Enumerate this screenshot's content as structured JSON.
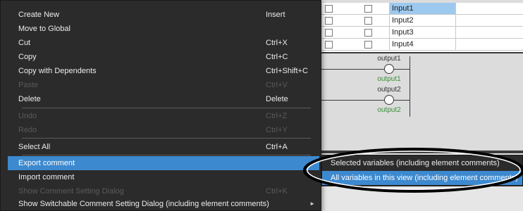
{
  "variables_table": {
    "rows": [
      {
        "name": "Input1",
        "selected": true
      },
      {
        "name": "Input2",
        "selected": false
      },
      {
        "name": "Input3",
        "selected": false
      },
      {
        "name": "Input4",
        "selected": false
      }
    ]
  },
  "ladder": {
    "coils": [
      {
        "label": "output1",
        "sub_label": "output1"
      },
      {
        "label": "output2",
        "sub_label": "output2"
      }
    ]
  },
  "context_menu": {
    "items": [
      {
        "label": "Create New",
        "shortcut": "Insert",
        "disabled": false
      },
      {
        "label": "Move to Global",
        "shortcut": "",
        "disabled": false
      },
      {
        "label": "Cut",
        "shortcut": "Ctrl+X",
        "disabled": false
      },
      {
        "label": "Copy",
        "shortcut": "Ctrl+C",
        "disabled": false
      },
      {
        "label": "Copy with Dependents",
        "shortcut": "Ctrl+Shift+C",
        "disabled": false
      },
      {
        "label": "Paste",
        "shortcut": "Ctrl+V",
        "disabled": true
      },
      {
        "label": "Delete",
        "shortcut": "Delete",
        "disabled": false
      },
      {
        "label": "Undo",
        "shortcut": "Ctrl+Z",
        "disabled": true
      },
      {
        "label": "Redo",
        "shortcut": "Ctrl+Y",
        "disabled": true
      },
      {
        "label": "Select All",
        "shortcut": "Ctrl+A",
        "disabled": false
      },
      {
        "label": "Export comment",
        "shortcut": "",
        "disabled": false,
        "highlighted": true,
        "has_submenu": true
      },
      {
        "label": "Import comment",
        "shortcut": "",
        "disabled": false
      },
      {
        "label": "Show Comment Setting Dialog",
        "shortcut": "Ctrl+K",
        "disabled": true
      },
      {
        "label": "Show Switchable Comment Setting Dialog (including element comments)",
        "shortcut": "",
        "disabled": false,
        "has_submenu": true
      }
    ]
  },
  "submenu": {
    "items": [
      {
        "label": "Selected variables (including element comments)",
        "highlighted": false
      },
      {
        "label": "All variables in this view (including element comments)",
        "highlighted": true
      }
    ]
  },
  "colors": {
    "menu_bg": "#2b2b2b",
    "highlight": "#3d89cf",
    "selected_row": "#9ec9ef",
    "callout": "#000000"
  },
  "icons": {
    "submenu_arrow": "chevron-right-icon"
  }
}
